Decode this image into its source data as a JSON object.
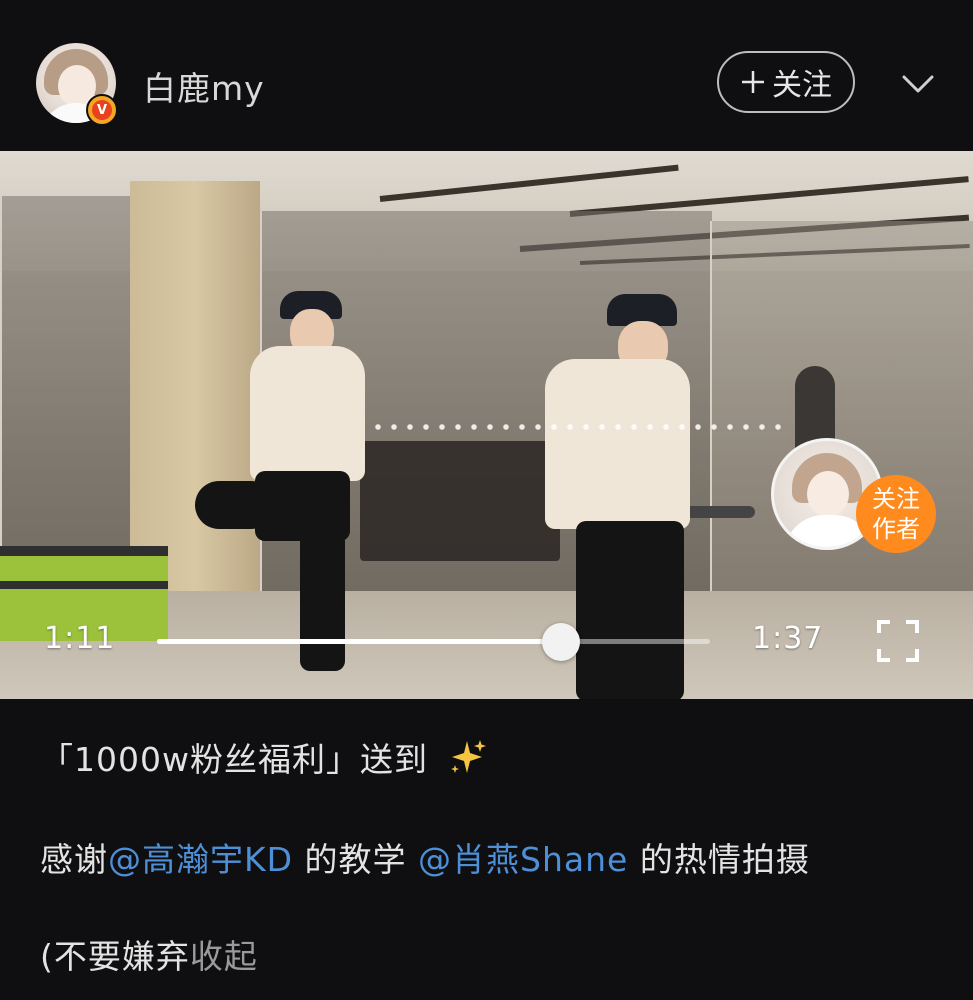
{
  "header": {
    "username": "白鹿my",
    "avatar_badge": "V",
    "follow_button": {
      "icon": "plus",
      "label": "关注"
    },
    "more_icon": "chevron-down-icon"
  },
  "video": {
    "current_time": "1:11",
    "duration": "1:37",
    "progress_percent": 73,
    "follow_author_line1": "关注",
    "follow_author_line2": "作者",
    "fullscreen_icon": "fullscreen-icon"
  },
  "caption": {
    "line1": "「1000w粉丝福利」送到",
    "line1_icon": "sparkles-icon",
    "line2_prefix": "感谢",
    "mention1": "@高瀚宇KD",
    "line2_middle": " 的教学 ",
    "mention2": "@肖燕Shane",
    "line2_suffix": " 的热情拍摄",
    "line3_text": "(不要嫌弃",
    "collapse_label": "收起"
  },
  "colors": {
    "background": "#0f0f11",
    "mention": "#4d90d8",
    "follow_author": "#ff8a1e",
    "sparkle": "#f5c542"
  }
}
